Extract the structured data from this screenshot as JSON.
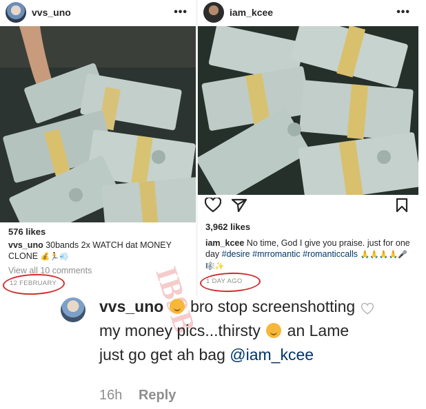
{
  "left_post": {
    "username": "vvs_uno",
    "likes": "576 likes",
    "caption_user": "vvs_uno",
    "caption_text": "30bands 2x WATCH dat MONEY CLONE",
    "caption_emojis": "💰🏃💨",
    "view_comments": "View all 10 comments",
    "timestamp": "12 FEBRUARY"
  },
  "right_post": {
    "username": "iam_kcee",
    "likes": "3,962 likes",
    "caption_user": "iam_kcee",
    "caption_text": "No time, God I give you praise. just for one day",
    "hashtags": [
      "#desire",
      "#mrromantic",
      "#romanticcalls"
    ],
    "caption_emojis": "🙏🙏🙏🙏🎤🎼✨",
    "timestamp": "1 DAY AGO"
  },
  "comment": {
    "username": "vvs_uno",
    "text_part1": "bro stop screenshotting my money pics...thirsty",
    "text_part2": "an Lame just go get ah bag",
    "mention": "@iam_kcee",
    "time": "16h",
    "reply_label": "Reply"
  },
  "watermark_text": "IB9B",
  "colors": {
    "annotation_red": "#d12c2c",
    "link_blue": "#003569",
    "meta_gray": "#8e8e8e"
  },
  "icons": [
    "more-icon",
    "heart-icon",
    "comment-icon",
    "share-icon",
    "bookmark-icon"
  ]
}
